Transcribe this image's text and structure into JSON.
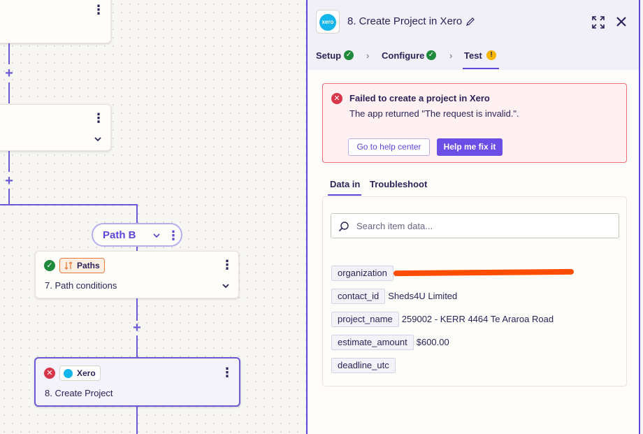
{
  "colors": {
    "accent": "#5b48d8",
    "success": "#1f8a3b",
    "error": "#d8364a",
    "warning": "#f5b600",
    "xero": "#13b5ea",
    "paths_badge": "#e37b3b",
    "redaction": "#ff4d00"
  },
  "canvas": {
    "path_pill": {
      "label": "Path B"
    },
    "step7": {
      "app_label": "Paths",
      "title": "7. Path conditions",
      "status": "success"
    },
    "step8": {
      "app_label": "Xero",
      "title": "8. Create Project",
      "status": "error"
    },
    "icons": {
      "kebab": "kebab-icon",
      "chevron": "chevron-down-icon",
      "add": "plus-icon"
    }
  },
  "panel": {
    "title": "8. Create Project in Xero",
    "logo_text": "xero",
    "tabs": [
      {
        "label": "Setup",
        "status": "success"
      },
      {
        "label": "Configure",
        "status": "success"
      },
      {
        "label": "Test",
        "status": "warning"
      }
    ],
    "active_tab": "Test",
    "error": {
      "title": "Failed to create a project in Xero",
      "message": "The app returned \"The request is invalid.\".",
      "help_button": "Go to help center",
      "fix_button": "Help me fix it"
    },
    "subtabs": [
      {
        "label": "Data in"
      },
      {
        "label": "Troubleshoot"
      }
    ],
    "active_subtab": "Data in",
    "search": {
      "placeholder": "Search item data..."
    },
    "fields": [
      {
        "key": "organization",
        "value": ""
      },
      {
        "key": "contact_id",
        "value": "Sheds4U Limited"
      },
      {
        "key": "project_name",
        "value": "259002 - KERR 4464 Te Araroa Road"
      },
      {
        "key": "estimate_amount",
        "value": "$600.00"
      },
      {
        "key": "deadline_utc",
        "value": ""
      }
    ]
  }
}
